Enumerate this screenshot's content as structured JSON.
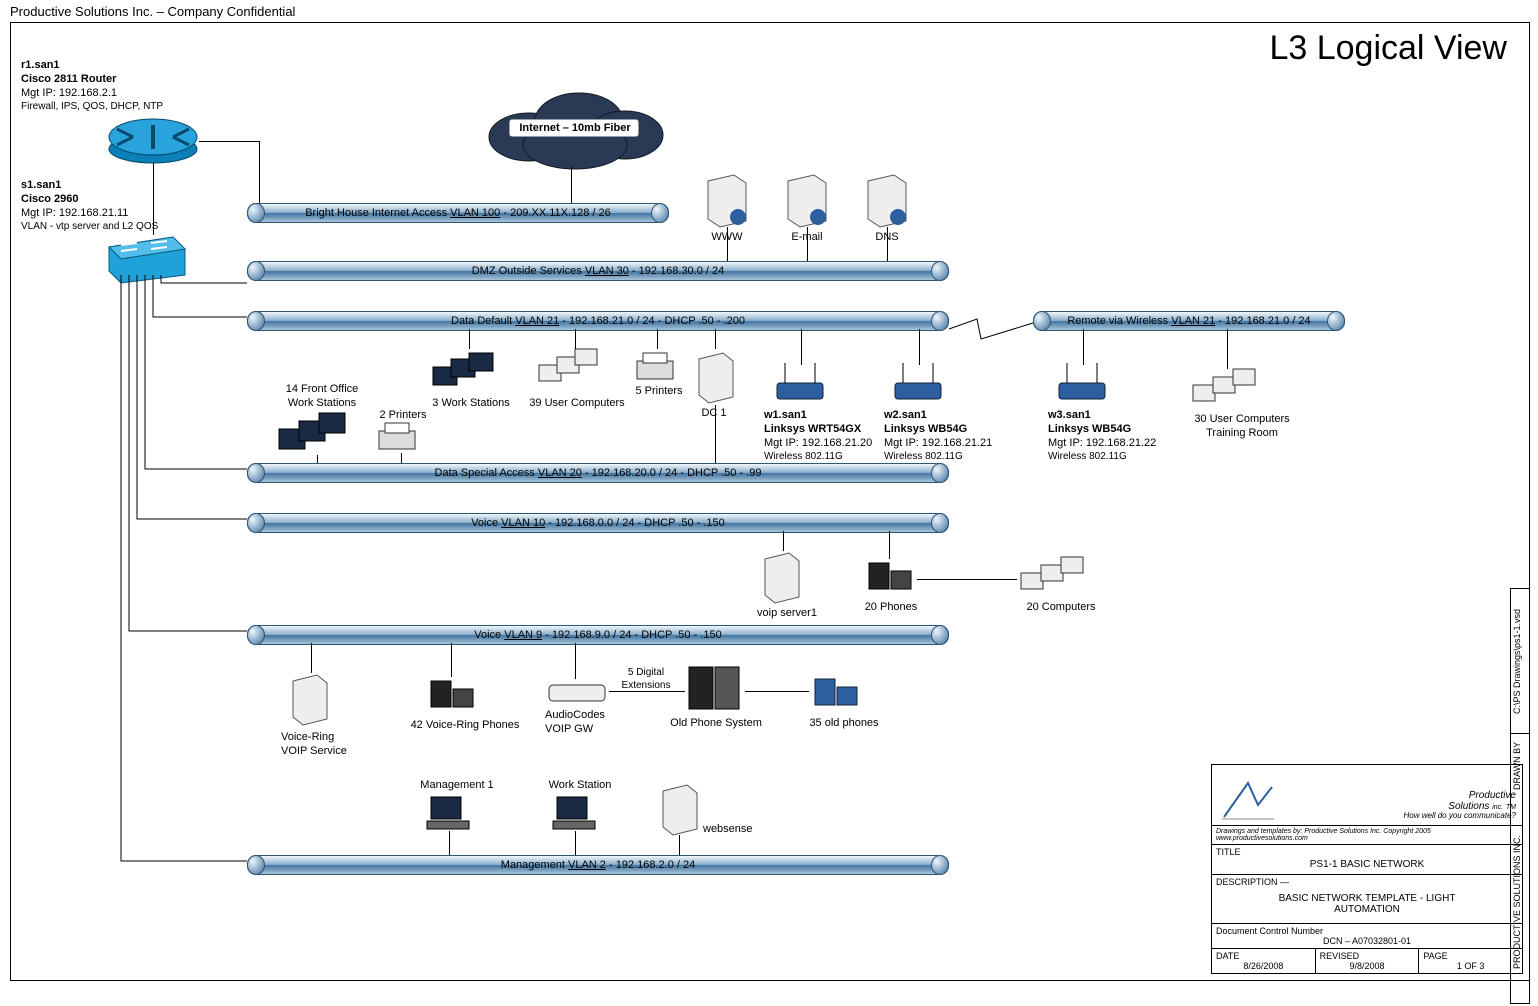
{
  "header": "Productive Solutions Inc. – Company Confidential",
  "title": "L3 Logical View",
  "router": {
    "name": "r1.san1",
    "model": "Cisco 2811 Router",
    "ip": "Mgt IP: 192.168.2.1",
    "notes": "Firewall, IPS, QOS, DHCP, NTP"
  },
  "switch": {
    "name": "s1.san1",
    "model": "Cisco 2960",
    "ip": "Mgt IP: 192.168.21.11",
    "notes": "VLAN - vtp server and L2 QOS"
  },
  "internet": "Internet – 10mb Fiber",
  "vlans": {
    "v100": {
      "label": "Bright House Internet Access ",
      "uvlan": "VLAN 100",
      "rest": " - 209.XX.11X.128 / 26"
    },
    "v30": {
      "label": "DMZ Outside Services ",
      "uvlan": "VLAN 30",
      "rest": " - 192.168.30.0 / 24"
    },
    "v21": {
      "label": "Data Default ",
      "uvlan": "VLAN 21",
      "rest": " - 192.168.21.0 / 24  - DHCP .50 - .200"
    },
    "v21r": {
      "label": "Remote via Wireless ",
      "uvlan": "VLAN 21",
      "rest": " - 192.168.21.0 / 24"
    },
    "v20": {
      "label": "Data Special Access ",
      "uvlan": "VLAN 20",
      "rest": " - 192.168.20.0 / 24  - DHCP .50 - .99"
    },
    "v10": {
      "label": "Voice ",
      "uvlan": "VLAN 10",
      "rest": " - 192.168.0.0 / 24  - DHCP .50 - .150"
    },
    "v9": {
      "label": "Voice ",
      "uvlan": "VLAN 9",
      "rest": " - 192.168.9.0 / 24  - DHCP .50 - .150"
    },
    "v2": {
      "label": "Management ",
      "uvlan": "VLAN 2",
      "rest": " - 192.168.2.0 / 24"
    }
  },
  "dmz": {
    "www": "WWW",
    "email": "E-mail",
    "dns": "DNS"
  },
  "data": {
    "front_office": "14 Front Office\nWork Stations",
    "two_printers": "2 Printers",
    "three_ws": "3 Work Stations",
    "users39": "39 User Computers",
    "five_printers": "5 Printers",
    "dc1": "DC 1",
    "w1": {
      "name": "w1.san1",
      "model": "Linksys WRT54GX",
      "ip": "Mgt IP: 192.168.21.20",
      "notes": "Wireless 802.11G"
    },
    "w2": {
      "name": "w2.san1",
      "model": "Linksys WB54G",
      "ip": "Mgt IP: 192.168.21.21",
      "notes": "Wireless 802.11G"
    },
    "w3": {
      "name": "w3.san1",
      "model": "Linksys WB54G",
      "ip": "Mgt IP: 192.168.21.22",
      "notes": "Wireless 802.11G"
    },
    "remote_users": "30 User Computers\nTraining Room"
  },
  "voice10": {
    "voip_server": "voip server1",
    "phones20": "20 Phones",
    "computers20": "20 Computers"
  },
  "voice9": {
    "voicering": "Voice-Ring\nVOIP Service",
    "phones42": "42 Voice-Ring Phones",
    "audiocodes": "AudioCodes\nVOIP GW",
    "digext": "5 Digital\nExtensions",
    "oldps": "Old Phone System",
    "old35": "35 old phones"
  },
  "mgmt": {
    "m1": "Management 1",
    "ws": "Work Station",
    "websense": "websense"
  },
  "titleblock": {
    "brand": "Productive\nSolutions",
    "brand_tag": "How well do you communicate?",
    "tm": "TM",
    "inc": "inc.",
    "credits": "Drawings and templates by: Productive Solutions Inc. Copyright 2005\nwww.productivesolutions.com",
    "title_label": "TITLE",
    "title_val": "PS1-1 BASIC NETWORK",
    "desc_label": "DESCRIPTION  —",
    "desc_val": "BASIC NETWORK TEMPLATE - LIGHT\nAUTOMATION",
    "dcn_label": "Document Control Number",
    "dcn_val": "DCN – A07032801-01",
    "date_label": "DATE",
    "date_val": "8/26/2008",
    "rev_label": "REVISED",
    "rev_val": "9/8/2008",
    "page_label": "PAGE",
    "page_val": "1 OF 3"
  },
  "side": {
    "path": "C:\\PS Drawings\\ps1-1.vsd",
    "drawn": "DRAWN BY",
    "company": "PRODUCTIVE SOLUTIONS INC."
  }
}
